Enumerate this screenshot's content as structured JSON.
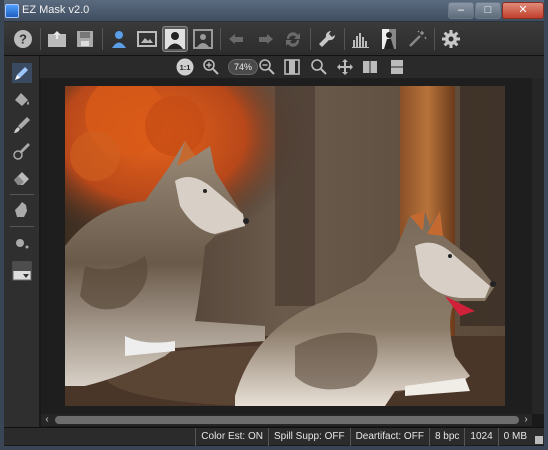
{
  "window": {
    "title": "EZ Mask v2.0",
    "controls": {
      "minimize": "–",
      "maximize": "□",
      "close": "✕"
    }
  },
  "toolbar": {
    "buttons": [
      {
        "icon": "help-icon",
        "label": "?"
      },
      {
        "icon": "open-icon"
      },
      {
        "icon": "save-icon"
      },
      {
        "icon": "person-blue-icon"
      },
      {
        "icon": "image-icon"
      },
      {
        "icon": "silhouette-icon",
        "active": true
      },
      {
        "icon": "silhouette-frame-icon"
      },
      {
        "icon": "undo-icon"
      },
      {
        "icon": "redo-icon"
      },
      {
        "icon": "refresh-icon"
      },
      {
        "icon": "wrench-icon"
      },
      {
        "icon": "histogram-icon"
      },
      {
        "icon": "bw-figure-icon"
      },
      {
        "icon": "magic-wand-icon"
      },
      {
        "icon": "gear-icon"
      }
    ]
  },
  "view_toolbar": {
    "actual_size_label": "1:1",
    "zoom_level": "74%"
  },
  "status": {
    "color_est": "Color Est: ON",
    "spill_supp": "Spill Supp: OFF",
    "deartifact": "Deartifact: OFF",
    "bpc": "8 bpc",
    "size": "1024",
    "memory": "0 MB"
  },
  "colors": {
    "accent": "#4a90e2",
    "toolbar_bg": "#2c2c2c",
    "canvas_bg": "#1e1e1e"
  }
}
